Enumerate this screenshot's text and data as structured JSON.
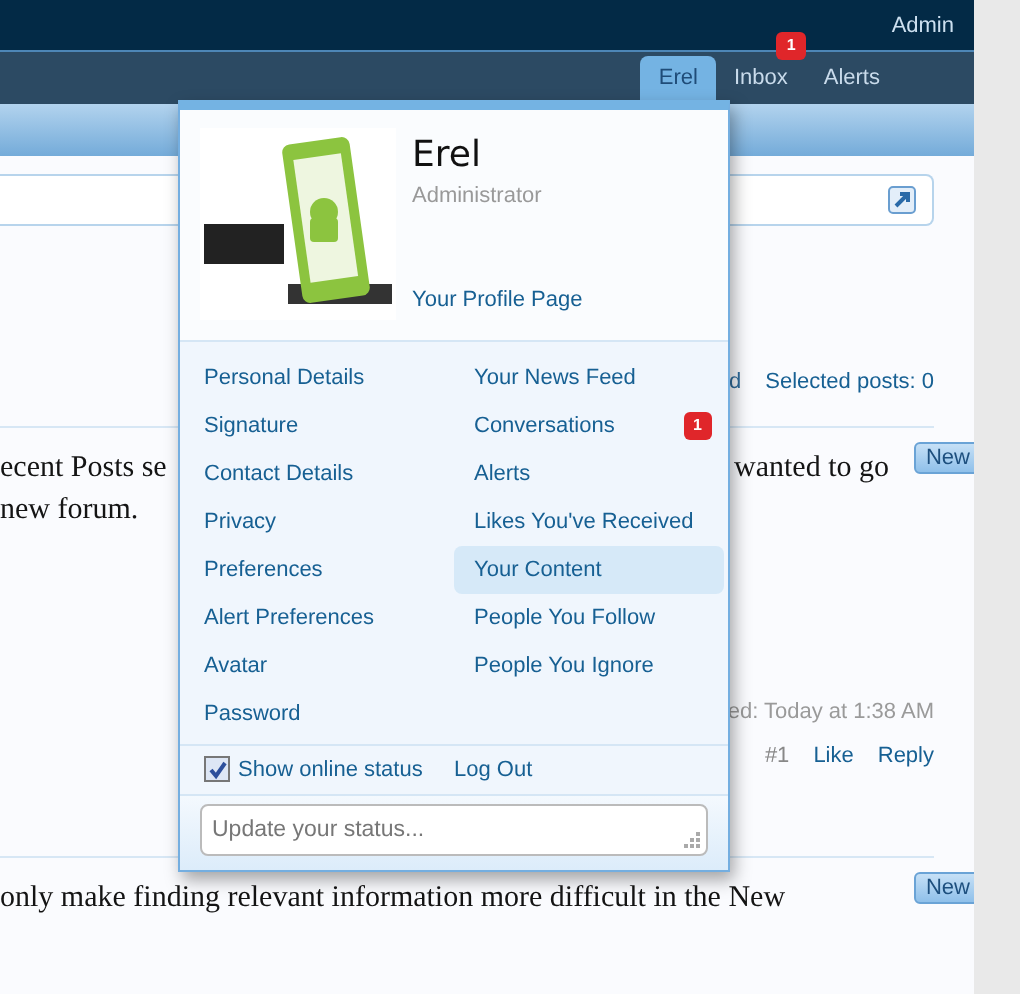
{
  "top_bar": {
    "user_link": "Admin"
  },
  "nav_tabs": [
    {
      "label": "Erel",
      "selected": true
    },
    {
      "label": "Inbox",
      "selected": false,
      "badge": "1"
    },
    {
      "label": "Alerts",
      "selected": false
    }
  ],
  "thread_bar": {
    "fragment": "d",
    "selected_posts": "Selected posts: 0"
  },
  "posts": [
    {
      "new_badge": "New",
      "lines": [
        {
          "left": "ecent Posts se",
          "right": "wanted to go"
        },
        {
          "left": "new forum."
        }
      ],
      "edited": "ed: Today at 1:38 AM",
      "number": "#1",
      "actions": [
        "Like",
        "Reply"
      ]
    },
    {
      "new_badge": "New",
      "lines": [
        {
          "left": "only make finding relevant information more difficult in the New"
        }
      ]
    }
  ],
  "user_menu": {
    "name": "Erel",
    "title": "Administrator",
    "profile_link": "Your Profile Page",
    "left_links": [
      "Personal Details",
      "Signature",
      "Contact Details",
      "Privacy",
      "Preferences",
      "Alert Preferences",
      "Avatar",
      "Password"
    ],
    "right_links": [
      {
        "label": "Your News Feed",
        "selected": false
      },
      {
        "label": "Conversations",
        "selected": false,
        "badge": "1"
      },
      {
        "label": "Alerts",
        "selected": false
      },
      {
        "label": "Likes You've Received",
        "selected": false
      },
      {
        "label": "Your Content",
        "selected": true
      },
      {
        "label": "People You Follow",
        "selected": false
      },
      {
        "label": "People You Ignore",
        "selected": false
      }
    ],
    "online_status": {
      "label": "Show online status",
      "checked": true
    },
    "logout": "Log Out",
    "status_field": {
      "placeholder": "Update your status..."
    }
  }
}
